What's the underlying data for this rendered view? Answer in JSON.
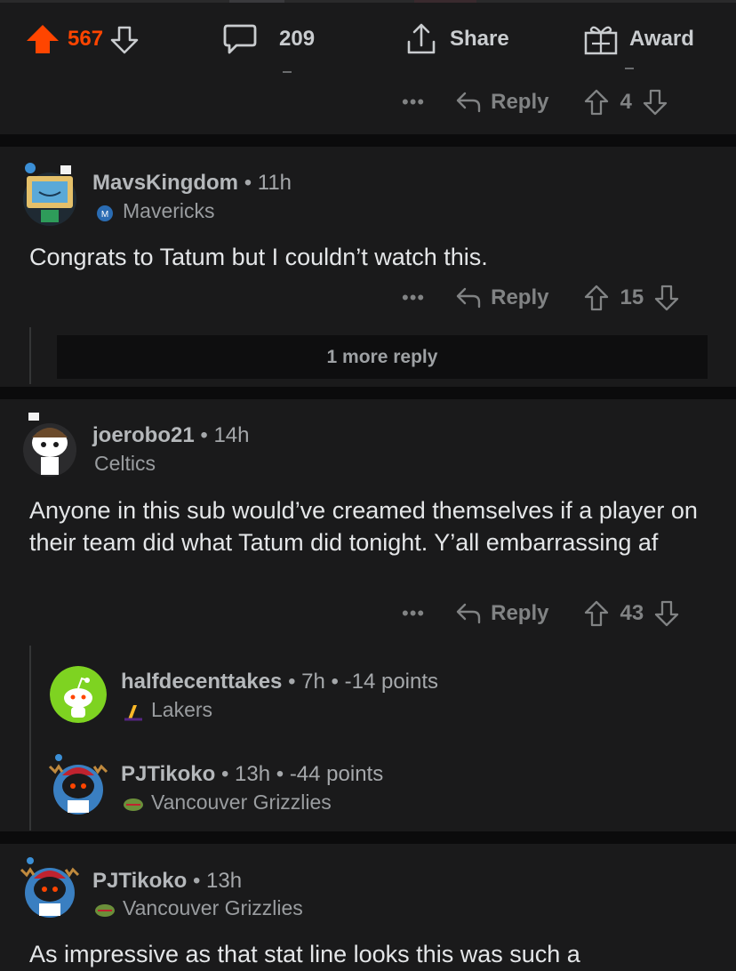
{
  "post_actions": {
    "upvote_count": "567",
    "comments_count": "209",
    "share_label": "Share",
    "award_label": "Award"
  },
  "first_comment_actions": {
    "more": "•••",
    "reply": "Reply",
    "votes": "4"
  },
  "comments": [
    {
      "username": "MavsKingdom",
      "time": "11h",
      "flair": "Mavericks",
      "body": "Congrats to Tatum but I couldn’t watch this.",
      "actions": {
        "more": "•••",
        "reply": "Reply",
        "votes": "15"
      },
      "more_replies": "1 more reply"
    },
    {
      "username": "joerobo21",
      "time": "14h",
      "flair": "Celtics",
      "body": "Anyone in this sub would’ve creamed themselves if a player on their team did what Tatum did tonight. Y’all embarrassing af",
      "actions": {
        "more": "•••",
        "reply": "Reply",
        "votes": "43"
      }
    }
  ],
  "collapsed_replies": [
    {
      "username": "halfdecenttakes",
      "time": "7h",
      "points": "-14 points",
      "flair": "Lakers"
    },
    {
      "username": "PJTikoko",
      "time": "13h",
      "points": "-44 points",
      "flair": "Vancouver Grizzlies"
    }
  ],
  "last_comment": {
    "username": "PJTikoko",
    "time": "13h",
    "flair": "Vancouver Grizzlies",
    "body": "As impressive as that stat line looks this was such a"
  },
  "colors": {
    "background": "#1a1a1b",
    "separator": "#0b0b0c",
    "upvote_orange": "#ff4500",
    "text": "#d7dadc",
    "muted": "#818384"
  },
  "flair_icons": {
    "mavericks": "mavericks-logo-icon",
    "lakers": "lakers-logo-icon",
    "grizzlies": "grizzlies-logo-icon"
  }
}
